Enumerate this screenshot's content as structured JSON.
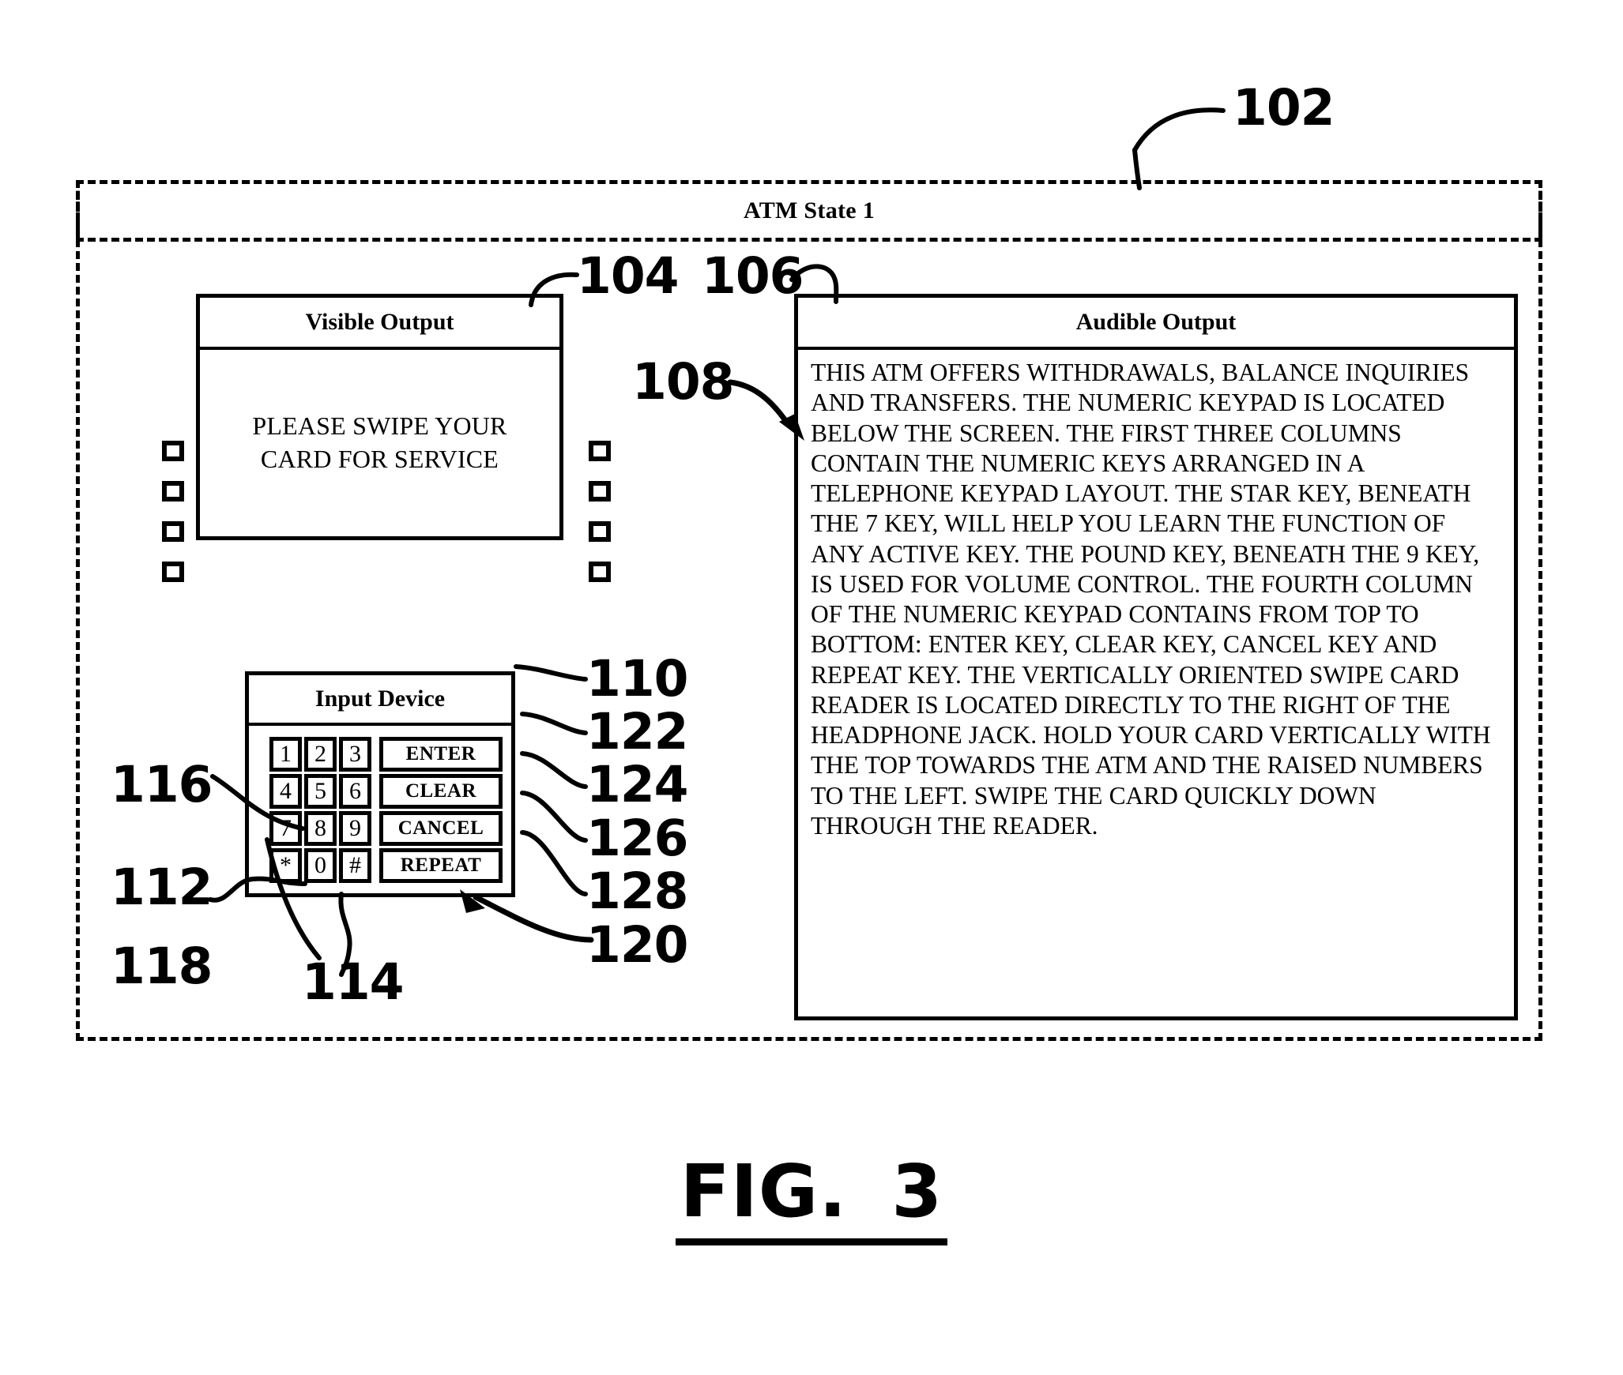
{
  "figure": {
    "caption_prefix": "FIG.",
    "caption_number": "3"
  },
  "state_container": {
    "ref": "102",
    "title": "ATM State 1"
  },
  "visible_output": {
    "ref": "104",
    "header": "Visible Output",
    "message": "PLEASE SWIPE YOUR CARD FOR SERVICE",
    "side_buttons_left": [
      "",
      "",
      "",
      ""
    ],
    "side_buttons_right": [
      "",
      "",
      "",
      ""
    ]
  },
  "audible_output": {
    "ref": "106",
    "text_ref": "108",
    "header": "Audible Output",
    "text": "THIS ATM OFFERS WITHDRAWALS, BALANCE INQUIRIES AND TRANSFERS. THE NUMERIC KEYPAD IS LOCATED BELOW THE SCREEN. THE FIRST THREE COLUMNS CONTAIN THE NUMERIC KEYS ARRANGED IN A TELEPHONE KEYPAD LAYOUT.  THE STAR KEY, BENEATH THE 7 KEY, WILL HELP YOU LEARN THE FUNCTION OF ANY ACTIVE KEY. THE POUND KEY, BENEATH THE 9 KEY, IS USED FOR VOLUME CONTROL. THE FOURTH COLUMN OF THE NUMERIC KEYPAD CONTAINS FROM TOP TO BOTTOM: ENTER KEY, CLEAR KEY, CANCEL KEY AND REPEAT KEY. THE VERTICALLY ORIENTED SWIPE CARD READER IS LOCATED DIRECTLY TO THE RIGHT OF THE HEADPHONE JACK. HOLD YOUR CARD VERTICALLY WITH THE TOP TOWARDS THE ATM AND THE RAISED NUMBERS TO THE LEFT. SWIPE THE CARD QUICKLY DOWN THROUGH THE READER."
  },
  "input_device": {
    "ref": "110",
    "header": "Input Device",
    "numeric_keys": [
      "1",
      "2",
      "3",
      "4",
      "5",
      "6",
      "7",
      "8",
      "9",
      "*",
      "0",
      "#"
    ],
    "function_keys": [
      "ENTER",
      "CLEAR",
      "CANCEL",
      "REPEAT"
    ],
    "refs": {
      "enter": "122",
      "clear": "124",
      "cancel": "126",
      "repeat": "128",
      "keypad_group": "120",
      "star_key": "112",
      "pound_key": "114",
      "numeric_block": "116",
      "zero_key": "118"
    }
  }
}
